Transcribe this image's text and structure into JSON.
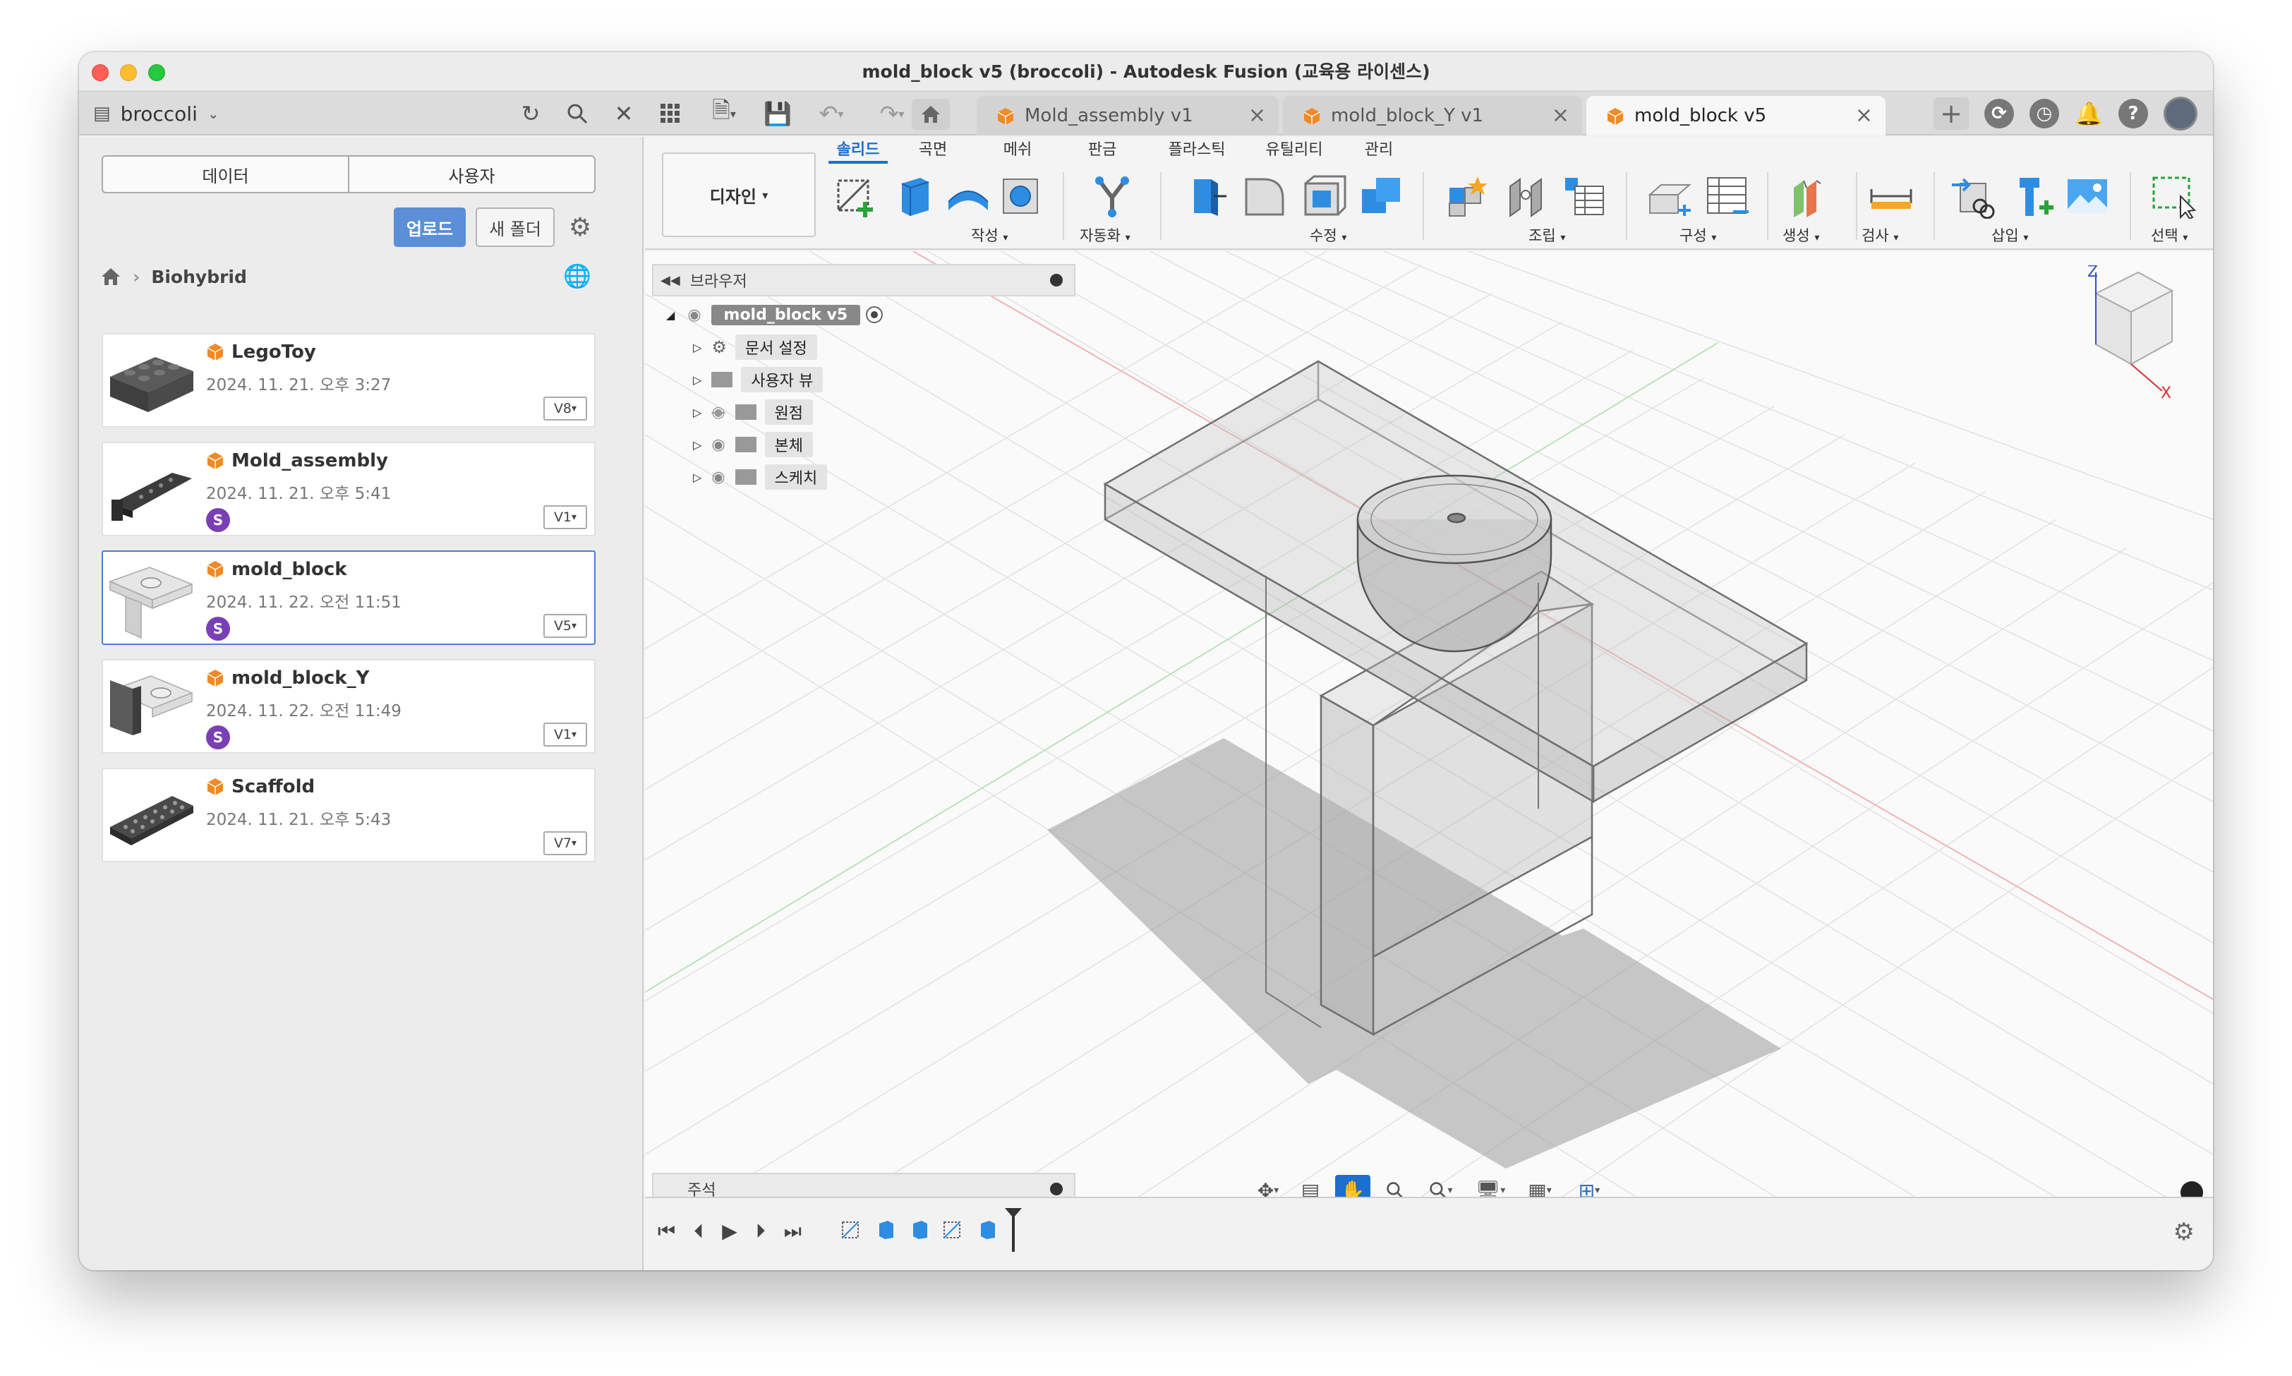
{
  "window": {
    "title": "mold_block v5 (broccoli) - Autodesk Fusion (교육용 라이센스)"
  },
  "appbar": {
    "team_name": "broccoli",
    "tabs": [
      {
        "label": "Mold_assembly v1",
        "active": false
      },
      {
        "label": "mold_block_Y v1",
        "active": false
      },
      {
        "label": "mold_block v5",
        "active": true
      }
    ]
  },
  "data_panel": {
    "segments": [
      "데이터",
      "사용자"
    ],
    "upload_label": "업로드",
    "new_folder_label": "새 폴더",
    "breadcrumb": "Biohybrid",
    "files": [
      {
        "name": "LegoToy",
        "date": "2024. 11. 21. 오후 3:27",
        "version": "V8",
        "badge": ""
      },
      {
        "name": "Mold_assembly",
        "date": "2024. 11. 21. 오후 5:41",
        "version": "V1",
        "badge": "S"
      },
      {
        "name": "mold_block",
        "date": "2024. 11. 22. 오전 11:51",
        "version": "V5",
        "badge": "S",
        "selected": true
      },
      {
        "name": "mold_block_Y",
        "date": "2024. 11. 22. 오전 11:49",
        "version": "V1",
        "badge": "S"
      },
      {
        "name": "Scaffold",
        "date": "2024. 11. 21. 오후 5:43",
        "version": "V7",
        "badge": ""
      }
    ]
  },
  "toolbar": {
    "workspace": "디자인",
    "tabs": [
      "솔리드",
      "곡면",
      "메쉬",
      "판금",
      "플라스틱",
      "유틸리티",
      "관리"
    ],
    "active_tab": "솔리드",
    "groups": [
      "작성",
      "자동화",
      "수정",
      "조립",
      "구성",
      "생성",
      "검사",
      "삽입",
      "선택"
    ]
  },
  "browser": {
    "title": "브라우저",
    "root": "mold_block v5",
    "items": [
      "문서 설정",
      "사용자 뷰",
      "원점",
      "본체",
      "스케치"
    ]
  },
  "notes_label": "주석",
  "viewcube": {
    "axis_z": "Z",
    "axis_x": "X"
  },
  "colors": {
    "accent": "#1c6fd1",
    "upload": "#5b8fd8",
    "badge": "#7b3fb5",
    "cube_icon": "#f08a24"
  }
}
